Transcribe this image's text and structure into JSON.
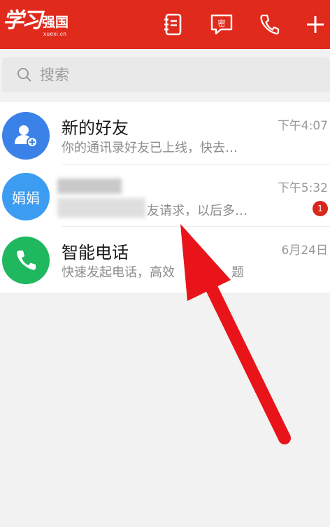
{
  "header": {
    "logo_script": "学习",
    "logo_main": "强国",
    "logo_sub": "xuexi.cn",
    "icons": [
      "contacts-book-icon",
      "secret-chat-icon",
      "phone-icon",
      "plus-icon"
    ],
    "secret_chat_glyph": "密",
    "bg_color": "#e02a1c"
  },
  "search": {
    "placeholder": "搜索"
  },
  "list": [
    {
      "title": "新的好友",
      "subtitle": "你的通讯录好友已上线，快去…",
      "time": "下午4:07",
      "avatar_icon": "add-friend-icon",
      "avatar_color": "#3b82e8"
    },
    {
      "avatar_text": "娟娟",
      "subtitle_visible": "友请求，以后多…",
      "time": "下午5:32",
      "badge": "1",
      "avatar_color": "#3b9cf2"
    },
    {
      "title": "智能电话",
      "subtitle": "快速发起电话，高效",
      "subtitle_tail": "题",
      "time": "6月24日",
      "avatar_icon": "phone-icon",
      "avatar_color": "#1fb85f"
    }
  ],
  "annotation": {
    "type": "red-arrow",
    "color": "#e8141a"
  }
}
